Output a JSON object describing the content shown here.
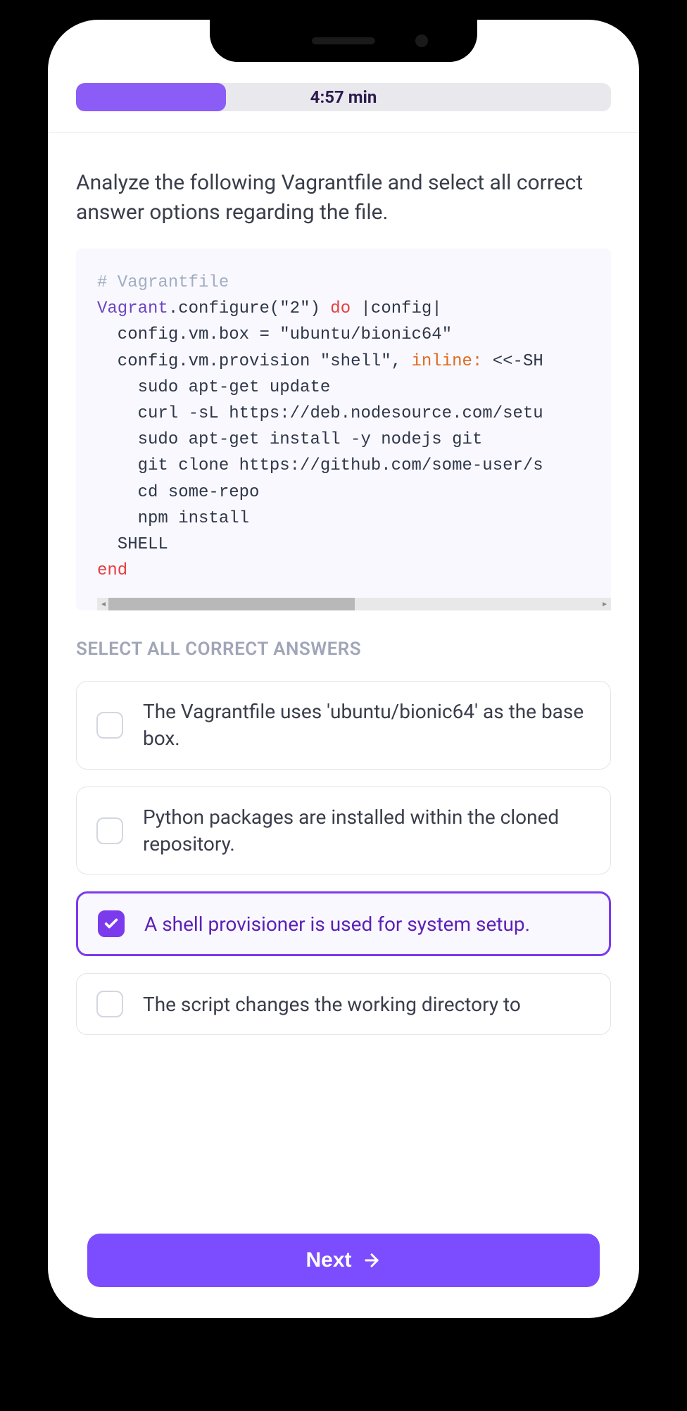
{
  "progress": {
    "timer": "4:57 min",
    "fill_percent": 28
  },
  "question": "Analyze the following Vagrantfile and select all correct answer options regarding the file.",
  "code": {
    "comment": "# Vagrantfile",
    "line2_a": "Vagrant",
    "line2_b": ".configure(",
    "line2_c": "\"2\"",
    "line2_d": ") ",
    "line2_e": "do",
    "line2_f": " |config|",
    "line3_a": "  config.vm.box = ",
    "line3_b": "\"ubuntu/bionic64\"",
    "line4_a": "  config.vm.provision ",
    "line4_b": "\"shell\"",
    "line4_c": ", ",
    "line4_d": "inline:",
    "line4_e": " <<-SH",
    "line5": "    sudo apt-get update",
    "line6": "    curl -sL https://deb.nodesource.com/setu",
    "line7": "    sudo apt-get install -y nodejs git",
    "line8": "    git clone https://github.com/some-user/s",
    "line9": "    cd some-repo",
    "line10": "    npm install",
    "line11": "  SHELL",
    "line12": "end"
  },
  "instruction": "SELECT ALL CORRECT ANSWERS",
  "options": [
    {
      "text": "The Vagrantfile uses 'ubuntu/bionic64' as the base box.",
      "checked": false
    },
    {
      "text": "Python packages are installed within the cloned repository.",
      "checked": false
    },
    {
      "text": "A shell provisioner is used for system setup.",
      "checked": true
    },
    {
      "text": "The script changes the working directory to",
      "checked": false
    }
  ],
  "next_label": "Next"
}
